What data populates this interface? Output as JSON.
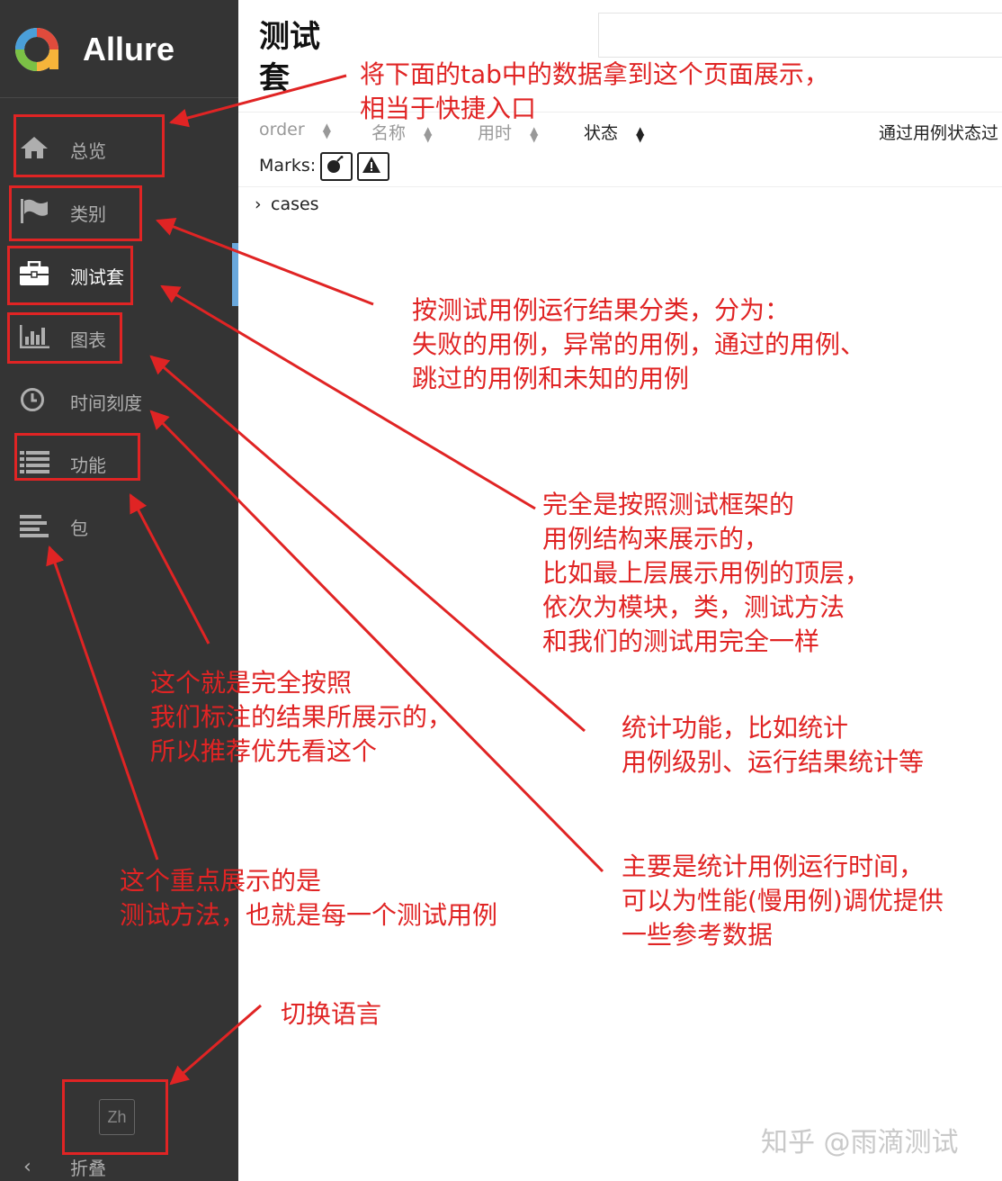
{
  "app": {
    "name": "Allure"
  },
  "nav": [
    {
      "label": "总览",
      "icon": "home-icon"
    },
    {
      "label": "类别",
      "icon": "flag-icon"
    },
    {
      "label": "测试套",
      "icon": "briefcase-icon",
      "active": true
    },
    {
      "label": "图表",
      "icon": "bar-chart-icon"
    },
    {
      "label": "时间刻度",
      "icon": "clock-icon"
    },
    {
      "label": "功能",
      "icon": "list-icon"
    },
    {
      "label": "包",
      "icon": "align-left-icon"
    }
  ],
  "footer": {
    "lang": "Zh",
    "collapse": "折叠"
  },
  "main": {
    "title": "测试套",
    "columns": [
      "order",
      "名称",
      "用时",
      "状态",
      "通过用例状态过"
    ],
    "marks_label": "Marks:",
    "tree": [
      "cases"
    ]
  },
  "annotations": [
    "将下面的tab中的数据拿到这个页面展示，\n相当于快捷入口",
    "按测试用例运行结果分类，分为：\n失败的用例，异常的用例，通过的用例、\n跳过的用例和未知的用例",
    "完全是按照测试框架的\n用例结构来展示的，\n比如最上层展示用例的顶层，\n依次为模块，类，测试方法\n和我们的测试用完全一样",
    "这个就是完全按照\n我们标注的结果所展示的，\n所以推荐优先看这个",
    "统计功能，比如统计\n用例级别、运行结果统计等",
    "主要是统计用例运行时间，\n可以为性能(慢用例)调优提供\n一些参考数据",
    "这个重点展示的是\n测试方法，也就是每一个测试用例",
    "切换语言"
  ],
  "watermark": "知乎 @雨滴测试",
  "colors": {
    "sidebar": "#343434",
    "annotation": "#e02424",
    "active_bar": "#6aa8dc"
  }
}
